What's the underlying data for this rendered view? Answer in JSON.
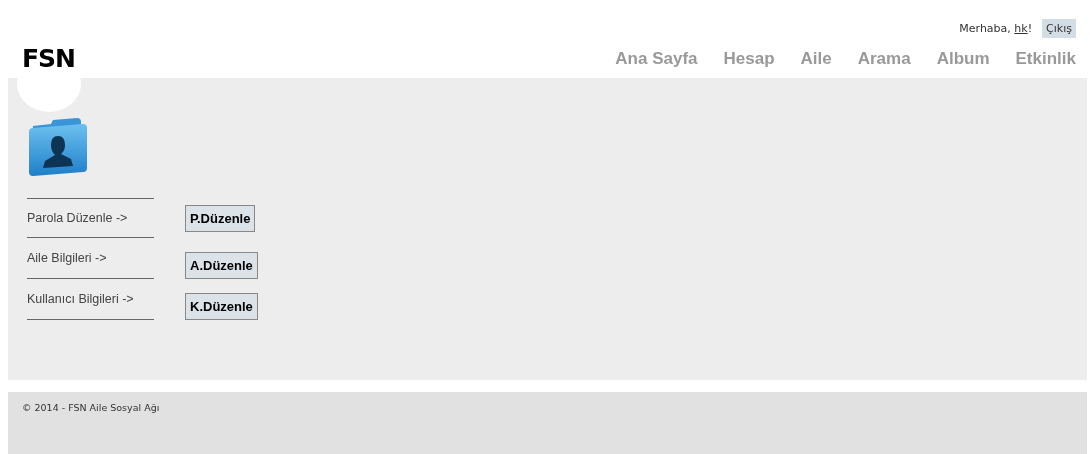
{
  "header": {
    "logo": "FSN",
    "greeting": {
      "prefix": "Merhaba, ",
      "user": "hk",
      "suffix": "!"
    },
    "logout": "Çıkış",
    "nav": [
      {
        "label": "Ana Sayfa"
      },
      {
        "label": "Hesap"
      },
      {
        "label": "Aile"
      },
      {
        "label": "Arama"
      },
      {
        "label": "Album"
      },
      {
        "label": "Etkinlik"
      }
    ]
  },
  "rows": [
    {
      "label": "Parola Düzenle ->",
      "button": "P.Düzenle"
    },
    {
      "label": "Aile Bilgileri ->",
      "button": "A.Düzenle"
    },
    {
      "label": "Kullanıcı Bilgileri ->",
      "button": "K.Düzenle"
    }
  ],
  "footer": {
    "text": "© 2014 - FSN Aile Sosyal Ağı"
  }
}
